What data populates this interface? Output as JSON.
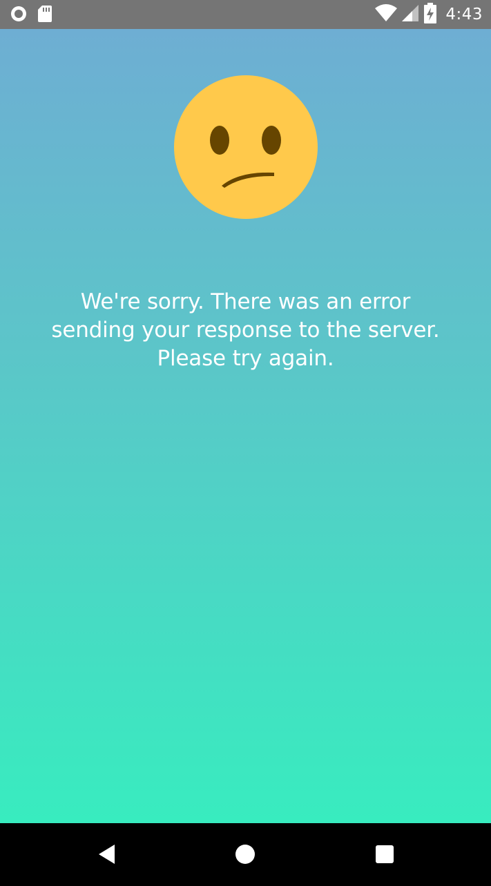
{
  "status_bar": {
    "time": "4:43",
    "icons": [
      "circle-notification-icon",
      "sd-card-icon",
      "wifi-icon",
      "signal-icon",
      "battery-charging-icon"
    ]
  },
  "main": {
    "message": "We're sorry. There was an error\nsending your response to the server.\nPlease try again.",
    "emoji": "confused-face-icon"
  },
  "nav_bar": {
    "icons": [
      "back-icon",
      "home-icon",
      "recents-icon"
    ]
  },
  "colors": {
    "status_bar": "#757575",
    "gradient_top": "#6eaed3",
    "gradient_bottom": "#38ecbf",
    "emoji_face": "#ffc94b",
    "emoji_features": "#664500",
    "nav_bar": "#000000"
  }
}
